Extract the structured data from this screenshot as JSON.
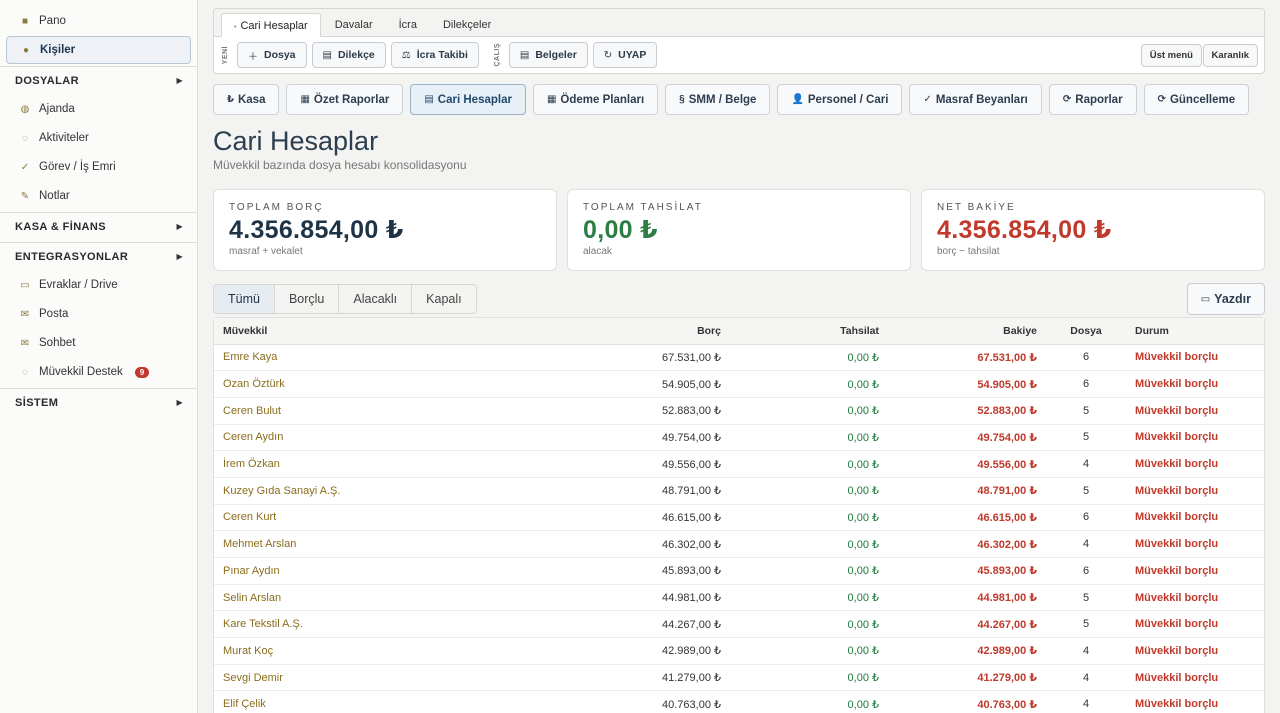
{
  "sidebar": {
    "pano": {
      "label": "Pano",
      "icon": "dashboard-icon"
    },
    "kisiler": {
      "label": "Kişiler",
      "icon": "people-icon"
    },
    "group_dosyalar": "DOSYALAR",
    "ajanda": {
      "label": "Ajanda",
      "icon": "calendar-icon"
    },
    "aktiviteler": {
      "label": "Aktiviteler",
      "icon": "activity-icon"
    },
    "gorev": {
      "label": "Görev / İş Emri",
      "icon": "check-icon"
    },
    "notlar": {
      "label": "Notlar",
      "icon": "pencil-icon"
    },
    "group_kasa": "KASA & FİNANS",
    "group_entegrasyonlar": "ENTEGRASYONLAR",
    "evraklar": {
      "label": "Evraklar / Drive",
      "icon": "folder-icon"
    },
    "posta": {
      "label": "Posta",
      "icon": "mail-icon"
    },
    "sohbet": {
      "label": "Sohbet",
      "icon": "chat-icon"
    },
    "destek": {
      "label": "Müvekkil Destek",
      "icon": "support-icon",
      "badge": "9"
    },
    "group_sistem": "SİSTEM"
  },
  "top_tabs": [
    "Cari Hesaplar",
    "Davalar",
    "İcra",
    "Dilekçeler"
  ],
  "toolbar": {
    "yeni_label": "YENİ",
    "calis_label": "ÇALIŞ",
    "dosya": "Dosya",
    "dilekce": "Dilekçe",
    "icra_takibi": "İcra Takibi",
    "belgeler": "Belgeler",
    "uyap": "UYAP",
    "ust_menu": "Üst menü",
    "karanlik": "Karanlık"
  },
  "module_buttons": [
    {
      "label": "Kasa",
      "icon": "₺"
    },
    {
      "label": "Özet Raporlar",
      "icon": "▦"
    },
    {
      "label": "Cari Hesaplar",
      "icon": "▤"
    },
    {
      "label": "Ödeme Planları",
      "icon": "▦"
    },
    {
      "label": "SMM / Belge",
      "icon": "§"
    },
    {
      "label": "Personel / Cari",
      "icon": "👤"
    },
    {
      "label": "Masraf Beyanları",
      "icon": "✓"
    },
    {
      "label": "Raporlar",
      "icon": "⟳"
    },
    {
      "label": "Güncelleme",
      "icon": "⟳"
    }
  ],
  "page": {
    "title": "Cari Hesaplar",
    "subtitle": "Müvekkil bazında dosya hesabı konsolidasyonu"
  },
  "summary": {
    "borc": {
      "label": "TOPLAM BORÇ",
      "value": "4.356.854,00 ₺",
      "note": "masraf + vekalet"
    },
    "tahsilat": {
      "label": "TOPLAM TAHSİLAT",
      "value": "0,00 ₺",
      "note": "alacak"
    },
    "net": {
      "label": "NET BAKİYE",
      "value": "4.356.854,00 ₺",
      "note": "borç − tahsilat"
    }
  },
  "filters": [
    "Tümü",
    "Borçlu",
    "Alacaklı",
    "Kapalı"
  ],
  "print_label": "Yazdır",
  "colors": {
    "debt": "#c0392b",
    "collected": "#2e7d45",
    "accent": "#1f3346"
  },
  "table": {
    "headers": {
      "muvekkil": "Müvekkil",
      "borc": "Borç",
      "tahsilat": "Tahsilat",
      "bakiye": "Bakiye",
      "dosya": "Dosya",
      "durum": "Durum"
    },
    "rows": [
      {
        "name": "Emre Kaya",
        "borc": "67.531,00 ₺",
        "tahsilat": "0,00 ₺",
        "bakiye": "67.531,00 ₺",
        "dosya": "6",
        "durum": "Müvekkil borçlu"
      },
      {
        "name": "Ozan Öztürk",
        "borc": "54.905,00 ₺",
        "tahsilat": "0,00 ₺",
        "bakiye": "54.905,00 ₺",
        "dosya": "6",
        "durum": "Müvekkil borçlu"
      },
      {
        "name": "Ceren Bulut",
        "borc": "52.883,00 ₺",
        "tahsilat": "0,00 ₺",
        "bakiye": "52.883,00 ₺",
        "dosya": "5",
        "durum": "Müvekkil borçlu"
      },
      {
        "name": "Ceren Aydın",
        "borc": "49.754,00 ₺",
        "tahsilat": "0,00 ₺",
        "bakiye": "49.754,00 ₺",
        "dosya": "5",
        "durum": "Müvekkil borçlu"
      },
      {
        "name": "İrem Özkan",
        "borc": "49.556,00 ₺",
        "tahsilat": "0,00 ₺",
        "bakiye": "49.556,00 ₺",
        "dosya": "4",
        "durum": "Müvekkil borçlu"
      },
      {
        "name": "Kuzey Gıda Sanayi A.Ş.",
        "borc": "48.791,00 ₺",
        "tahsilat": "0,00 ₺",
        "bakiye": "48.791,00 ₺",
        "dosya": "5",
        "durum": "Müvekkil borçlu"
      },
      {
        "name": "Ceren Kurt",
        "borc": "46.615,00 ₺",
        "tahsilat": "0,00 ₺",
        "bakiye": "46.615,00 ₺",
        "dosya": "6",
        "durum": "Müvekkil borçlu"
      },
      {
        "name": "Mehmet Arslan",
        "borc": "46.302,00 ₺",
        "tahsilat": "0,00 ₺",
        "bakiye": "46.302,00 ₺",
        "dosya": "4",
        "durum": "Müvekkil borçlu"
      },
      {
        "name": "Pınar Aydın",
        "borc": "45.893,00 ₺",
        "tahsilat": "0,00 ₺",
        "bakiye": "45.893,00 ₺",
        "dosya": "6",
        "durum": "Müvekkil borçlu"
      },
      {
        "name": "Selin Arslan",
        "borc": "44.981,00 ₺",
        "tahsilat": "0,00 ₺",
        "bakiye": "44.981,00 ₺",
        "dosya": "5",
        "durum": "Müvekkil borçlu"
      },
      {
        "name": "Kare Tekstil A.Ş.",
        "borc": "44.267,00 ₺",
        "tahsilat": "0,00 ₺",
        "bakiye": "44.267,00 ₺",
        "dosya": "5",
        "durum": "Müvekkil borçlu"
      },
      {
        "name": "Murat Koç",
        "borc": "42.989,00 ₺",
        "tahsilat": "0,00 ₺",
        "bakiye": "42.989,00 ₺",
        "dosya": "4",
        "durum": "Müvekkil borçlu"
      },
      {
        "name": "Sevgi Demir",
        "borc": "41.279,00 ₺",
        "tahsilat": "0,00 ₺",
        "bakiye": "41.279,00 ₺",
        "dosya": "4",
        "durum": "Müvekkil borçlu"
      },
      {
        "name": "Elif Çelik",
        "borc": "40.763,00 ₺",
        "tahsilat": "0,00 ₺",
        "bakiye": "40.763,00 ₺",
        "dosya": "4",
        "durum": "Müvekkil borçlu"
      }
    ]
  }
}
